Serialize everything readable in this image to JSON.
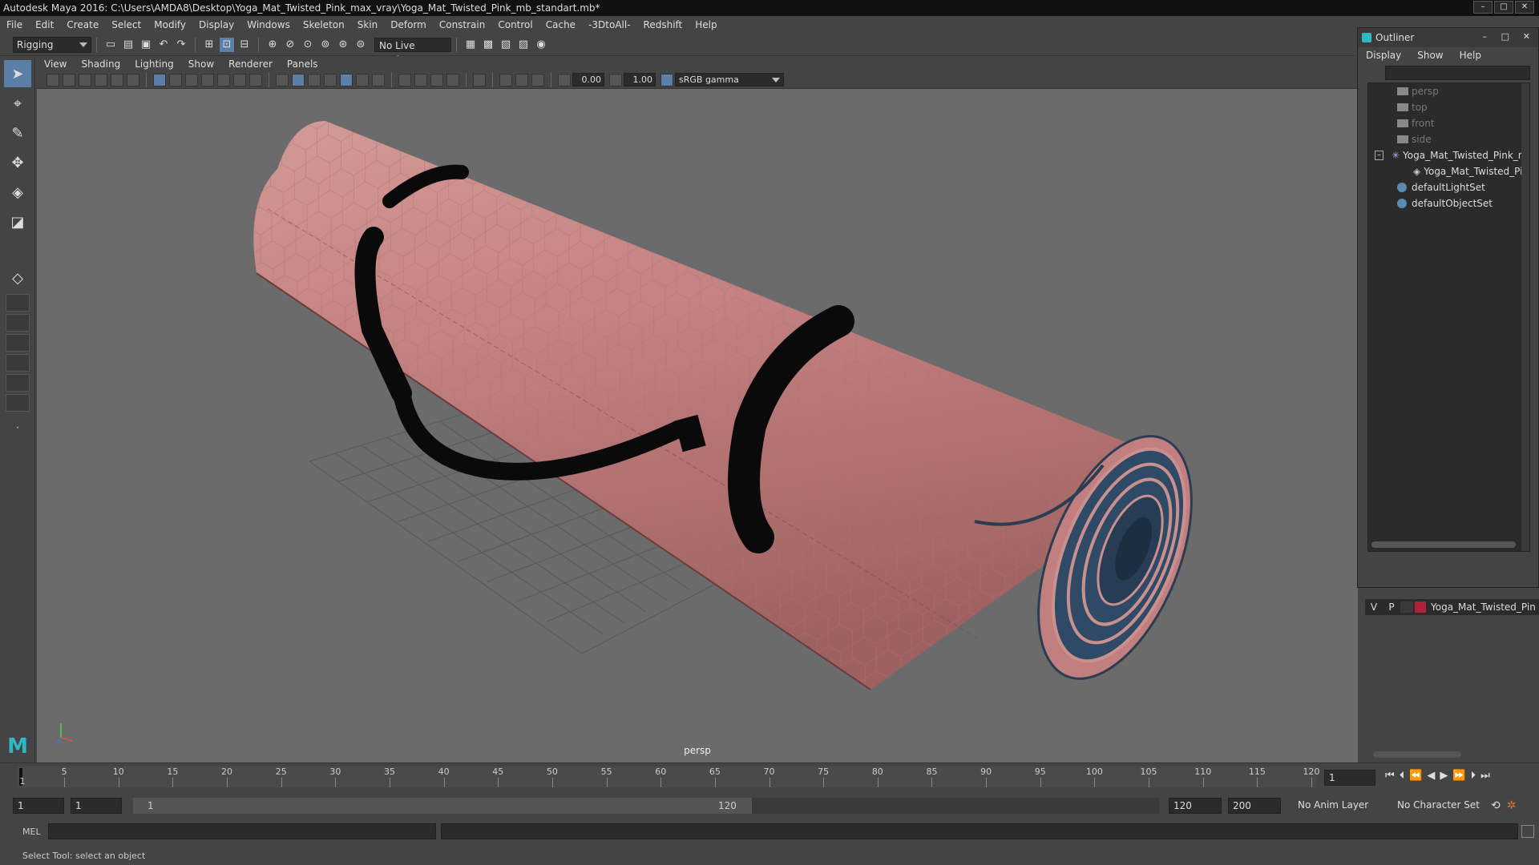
{
  "window": {
    "title": "Autodesk Maya 2016: C:\\Users\\AMDA8\\Desktop\\Yoga_Mat_Twisted_Pink_max_vray\\Yoga_Mat_Twisted_Pink_mb_standart.mb*",
    "buttons": [
      "minimize",
      "maximize",
      "close"
    ]
  },
  "menubar": {
    "items": [
      "File",
      "Edit",
      "Create",
      "Select",
      "Modify",
      "Display",
      "Windows",
      "Skeleton",
      "Skin",
      "Deform",
      "Constrain",
      "Control",
      "Cache",
      "-3DtoAll-",
      "Redshift",
      "Help"
    ]
  },
  "shelf": {
    "mode": "Rigging",
    "live_surface": "No Live Surface"
  },
  "panel": {
    "menus": [
      "View",
      "Shading",
      "Lighting",
      "Show",
      "Renderer",
      "Panels"
    ],
    "exposure": "0.00",
    "gamma": "1.00",
    "color_space": "sRGB gamma",
    "camera_label": "persp"
  },
  "outliner": {
    "title": "Outliner",
    "menus": [
      "Display",
      "Show",
      "Help"
    ],
    "items": [
      {
        "label": "persp",
        "dim": true
      },
      {
        "label": "top",
        "dim": true
      },
      {
        "label": "front",
        "dim": true
      },
      {
        "label": "side",
        "dim": true
      },
      {
        "label": "Yoga_Mat_Twisted_Pink_nc",
        "dim": false
      },
      {
        "label": "Yoga_Mat_Twisted_Pin",
        "dim": false
      },
      {
        "label": "defaultLightSet",
        "dim": false
      },
      {
        "label": "defaultObjectSet",
        "dim": false
      }
    ]
  },
  "layers": {
    "v": "V",
    "p": "P",
    "name": "Yoga_Mat_Twisted_Pin",
    "color": "#b0203a"
  },
  "timeline": {
    "ticks": [
      "5",
      "10",
      "15",
      "20",
      "25",
      "30",
      "35",
      "40",
      "45",
      "50",
      "55",
      "60",
      "65",
      "70",
      "75",
      "80",
      "85",
      "90",
      "95",
      "100",
      "105",
      "110",
      "115",
      "120"
    ],
    "current_frame_marker": "1",
    "current_frame": "1"
  },
  "range": {
    "start": "1",
    "anim_start": "1",
    "slider_start": "1",
    "slider_end": "120",
    "anim_end": "120",
    "end": "200",
    "anim_layer": "No Anim Layer",
    "character_set": "No Character Set"
  },
  "cmdline": {
    "label": "MEL"
  },
  "helpline": {
    "text": "Select Tool: select an object"
  },
  "colors": {
    "mat_pink": "#c27f7f",
    "mat_blue": "#2f4a66",
    "strap": "#0a0a0a",
    "viewport_bg": "#6b6b6b",
    "accent": "#5b7fa6"
  }
}
